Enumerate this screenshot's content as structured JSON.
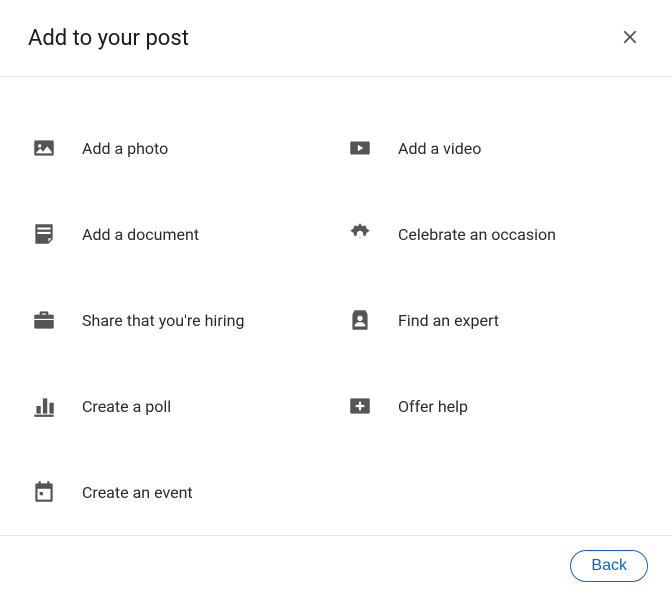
{
  "header": {
    "title": "Add to your post"
  },
  "options": {
    "add_photo": "Add a photo",
    "add_video": "Add a video",
    "add_document": "Add a document",
    "celebrate_occasion": "Celebrate an occasion",
    "share_hiring": "Share that you're hiring",
    "find_expert": "Find an expert",
    "create_poll": "Create a poll",
    "offer_help": "Offer help",
    "create_event": "Create an event"
  },
  "footer": {
    "back_label": "Back"
  }
}
